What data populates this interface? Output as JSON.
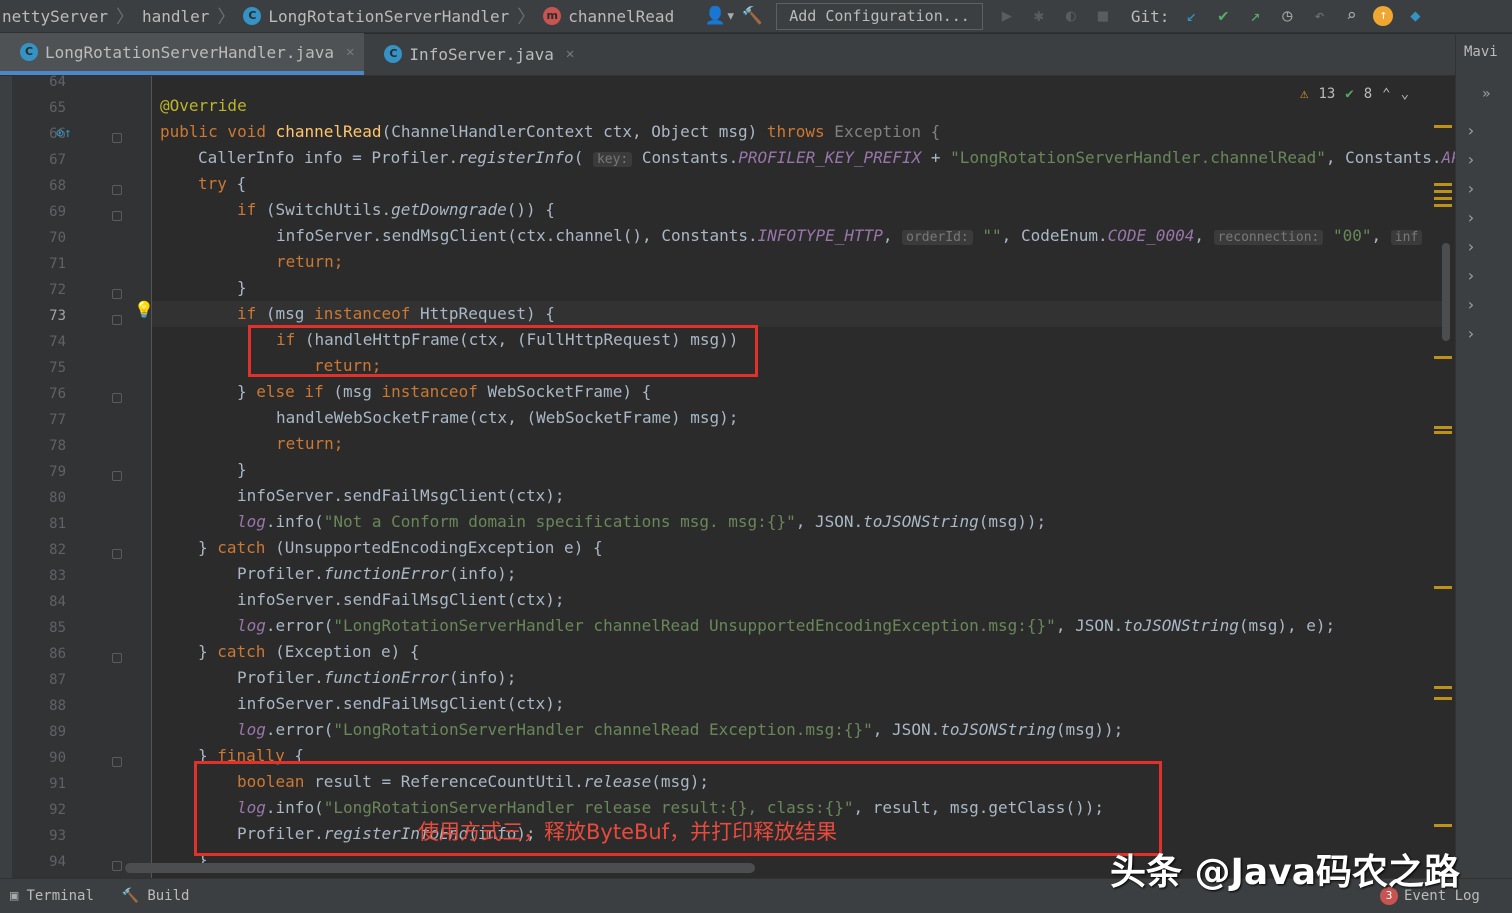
{
  "breadcrumbs": {
    "project": "nettyServer",
    "package": "handler",
    "class_name": "LongRotationServerHandler",
    "method": "channelRead"
  },
  "toolbar": {
    "add_configuration": "Add Configuration...",
    "git_label": "Git:"
  },
  "tabs": [
    {
      "label": "LongRotationServerHandler.java",
      "icon": "C",
      "active": true
    },
    {
      "label": "InfoServer.java",
      "icon": "C",
      "active": false
    }
  ],
  "right_panel": {
    "label": "Mavi"
  },
  "inspection": {
    "warnings": "13",
    "checks": "8"
  },
  "line_numbers": [
    "64",
    "65",
    "66",
    "67",
    "68",
    "69",
    "70",
    "71",
    "72",
    "73",
    "74",
    "75",
    "76",
    "77",
    "78",
    "79",
    "80",
    "81",
    "82",
    "83",
    "84",
    "85",
    "86",
    "87",
    "88",
    "89",
    "90",
    "91",
    "92",
    "93",
    "94"
  ],
  "code": {
    "l65": "@Override",
    "l66_mod": "public void ",
    "l66_name": "channelRead",
    "l66_params": "(ChannelHandlerContext ctx, Object msg) ",
    "l66_throws": "throws",
    "l66_exc": " Exception {",
    "l67_a": "CallerInfo info = Profiler.",
    "l67_fn": "registerInfo",
    "l67_b": "( ",
    "l67_hint": "key:",
    "l67_c": " Constants.",
    "l67_const": "PROFILER_KEY_PREFIX",
    "l67_d": " + ",
    "l67_str": "\"LongRotationServerHandler.channelRead\"",
    "l67_e": ", Constants.",
    "l67_const2": "AP",
    "l68_kw": "try",
    "l68_rest": " {",
    "l69_kw": "if",
    "l69_a": " (SwitchUtils.",
    "l69_fn": "getDowngrade",
    "l69_b": "()) {",
    "l70_a": "infoServer.sendMsgClient(ctx.channel(), Constants.",
    "l70_const": "INFOTYPE_HTTP",
    "l70_b": ", ",
    "l70_hint1": "orderId:",
    "l70_str1": " \"\"",
    "l70_c": ", CodeEnum.",
    "l70_const2": "CODE_0004",
    "l70_d": ", ",
    "l70_hint2": "reconnection:",
    "l70_str2": " \"00\"",
    "l70_e": ", ",
    "l70_hint3": "inf",
    "l71": "return;",
    "l72": "}",
    "l73_kw": "if",
    "l73_a": " (msg ",
    "l73_kw2": "instanceof",
    "l73_b": " HttpRequest) {",
    "l74_kw": "if",
    "l74_a": " (handleHttpFrame(ctx, (FullHttpRequest) msg))",
    "l75": "return;",
    "l76_a": "} ",
    "l76_kw": "else if",
    "l76_b": " (msg ",
    "l76_kw2": "instanceof",
    "l76_c": " WebSocketFrame) {",
    "l77": "handleWebSocketFrame(ctx, (WebSocketFrame) msg);",
    "l78": "return;",
    "l79": "}",
    "l80": "infoServer.sendFailMsgClient(ctx);",
    "l81_log": "log",
    "l81_a": ".info(",
    "l81_str": "\"Not a Conform domain specifications msg. msg:{}\"",
    "l81_b": ", JSON.",
    "l81_fn": "toJSONString",
    "l81_c": "(msg));",
    "l82_a": "} ",
    "l82_kw": "catch",
    "l82_b": " (UnsupportedEncodingException e) {",
    "l83_a": "Profiler.",
    "l83_fn": "functionError",
    "l83_b": "(info);",
    "l84": "infoServer.sendFailMsgClient(ctx);",
    "l85_log": "log",
    "l85_a": ".error(",
    "l85_str": "\"LongRotationServerHandler channelRead UnsupportedEncodingException.msg:{}\"",
    "l85_b": ", JSON.",
    "l85_fn": "toJSONString",
    "l85_c": "(msg), e);",
    "l86_a": "} ",
    "l86_kw": "catch",
    "l86_b": " (Exception e) {",
    "l87_a": "Profiler.",
    "l87_fn": "functionError",
    "l87_b": "(info);",
    "l88": "infoServer.sendFailMsgClient(ctx);",
    "l89_log": "log",
    "l89_a": ".error(",
    "l89_str": "\"LongRotationServerHandler channelRead Exception.msg:{}\"",
    "l89_b": ", JSON.",
    "l89_fn": "toJSONString",
    "l89_c": "(msg));",
    "l90_a": "} ",
    "l90_kw": "finally",
    "l90_b": " {",
    "l91_kw": "boolean",
    "l91_a": " result = ReferenceCountUtil.",
    "l91_fn": "release",
    "l91_b": "(msg);",
    "l92_log": "log",
    "l92_a": ".info(",
    "l92_str": "\"LongRotationServerHandler release result:{}, class:{}\"",
    "l92_b": ", result, msg.getClass());",
    "l93_a": "Profiler.",
    "l93_fn": "registerInfoEnd",
    "l93_b": "(info);",
    "l94": "}"
  },
  "annotation_text": "使用方式三，释放ByteBuf，并打印释放结果",
  "watermark": "头条 @Java码农之路",
  "bottom": {
    "terminal": "Terminal",
    "build": "Build",
    "event_log": "Event Log",
    "event_count": "3"
  },
  "colors": {
    "background": "#2b2b2b",
    "keyword": "#cc7832",
    "string": "#6a8759",
    "method_decl": "#ffc66d",
    "constant": "#9876aa",
    "highlight_box": "#e0312b"
  }
}
